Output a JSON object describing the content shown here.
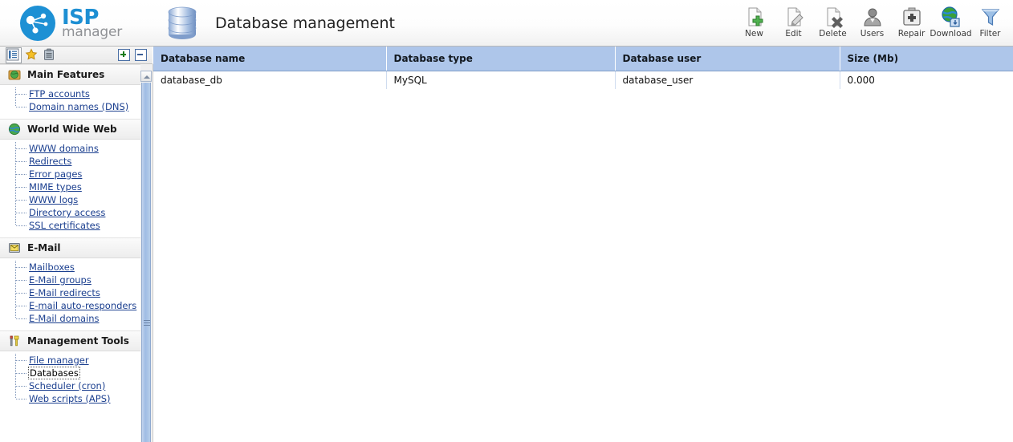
{
  "header": {
    "logo_primary": "ISP",
    "logo_secondary": "manager",
    "page_title": "Database management",
    "page_icon": "database-stack-icon"
  },
  "toolbar": {
    "buttons": [
      {
        "label": "New",
        "icon": "page-add-icon"
      },
      {
        "label": "Edit",
        "icon": "page-pencil-icon"
      },
      {
        "label": "Delete",
        "icon": "page-delete-icon"
      },
      {
        "label": "Users",
        "icon": "user-icon"
      },
      {
        "label": "Repair",
        "icon": "first-aid-kit-icon"
      },
      {
        "label": "Download",
        "icon": "globe-download-icon"
      },
      {
        "label": "Filter",
        "icon": "funnel-icon"
      }
    ]
  },
  "sidebar": {
    "toolbar_icons": [
      {
        "name": "list-view-icon"
      },
      {
        "name": "star-favorites-icon"
      },
      {
        "name": "clipboard-icon"
      }
    ],
    "expand_all_label": "+",
    "collapse_all_label": "-",
    "sections": [
      {
        "title": "Main Features",
        "icon": "globe-box-icon",
        "items": [
          {
            "label": "FTP accounts",
            "active": false
          },
          {
            "label": "Domain names (DNS)",
            "active": false
          }
        ]
      },
      {
        "title": "World Wide Web",
        "icon": "globe-www-icon",
        "items": [
          {
            "label": "WWW domains",
            "active": false
          },
          {
            "label": "Redirects",
            "active": false
          },
          {
            "label": "Error pages",
            "active": false
          },
          {
            "label": "MIME types",
            "active": false
          },
          {
            "label": "WWW logs",
            "active": false
          },
          {
            "label": "Directory access",
            "active": false
          },
          {
            "label": "SSL certificates",
            "active": false
          }
        ]
      },
      {
        "title": "E-Mail",
        "icon": "envelope-icon",
        "items": [
          {
            "label": "Mailboxes",
            "active": false
          },
          {
            "label": "E-Mail groups",
            "active": false
          },
          {
            "label": "E-Mail redirects",
            "active": false
          },
          {
            "label": "E-mail auto-responders",
            "active": false
          },
          {
            "label": "E-Mail domains",
            "active": false
          }
        ]
      },
      {
        "title": "Management Tools",
        "icon": "tools-icon",
        "items": [
          {
            "label": "File manager",
            "active": false
          },
          {
            "label": "Databases",
            "active": true
          },
          {
            "label": "Scheduler (cron)",
            "active": false
          },
          {
            "label": "Web scripts (APS)",
            "active": false
          }
        ]
      }
    ]
  },
  "table": {
    "columns": [
      "Database name",
      "Database type",
      "Database user",
      "Size (Mb)"
    ],
    "rows": [
      {
        "database_name": "database_db",
        "database_type": "MySQL",
        "database_user": "database_user",
        "size_mb": "0.000"
      }
    ]
  },
  "colors": {
    "header_blue": "#aec6ea",
    "link_blue": "#1b3f8f",
    "brand_blue": "#1d8fd3",
    "scrollbar_blue": "#9fbce4"
  }
}
